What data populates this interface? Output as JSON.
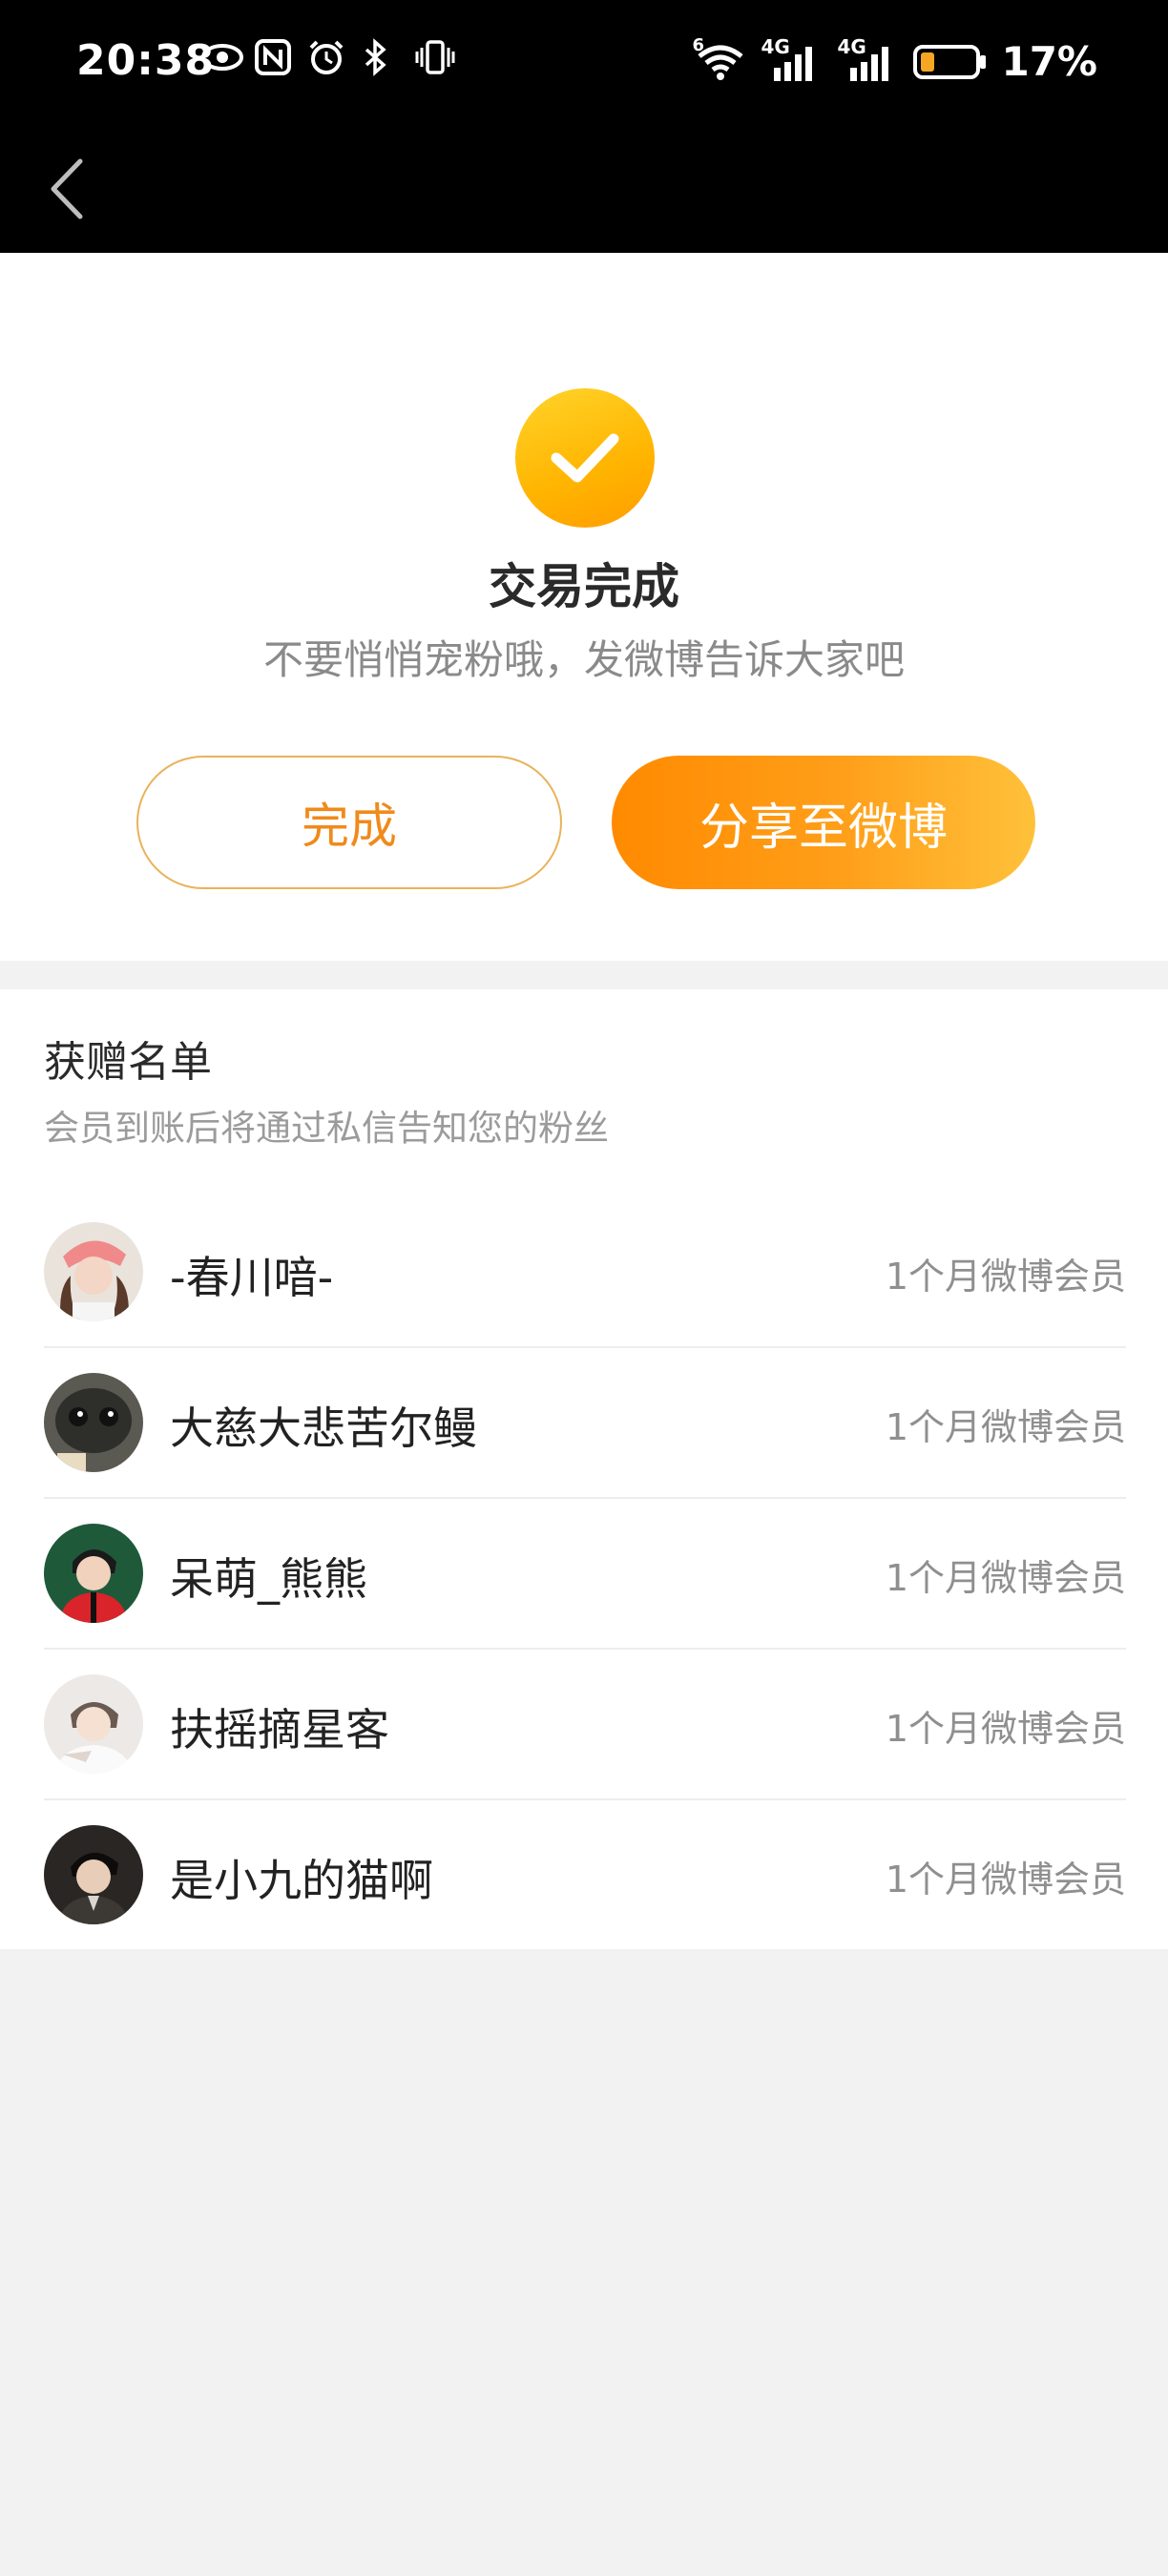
{
  "status_bar": {
    "time": "20:38",
    "battery_percent": "17%",
    "left_icons": [
      "eye-icon",
      "nfc-icon",
      "alarm-icon",
      "bluetooth-icon",
      "vibrate-icon"
    ],
    "right_icons": [
      "wifi-icon",
      "signal-4g-icon",
      "signal-4g-icon",
      "battery-icon"
    ],
    "signal_label_1": "4G",
    "signal_label_2": "4G",
    "wifi_label": "6"
  },
  "nav": {
    "back_icon": "chevron-left-icon"
  },
  "result": {
    "title": "交易完成",
    "subtitle": "不要悄悄宠粉哦，发微博告诉大家吧",
    "done_label": "完成",
    "share_label": "分享至微博",
    "accent_color": "#ffb400"
  },
  "recipients": {
    "title": "获赠名单",
    "subtitle": "会员到账后将通过私信告知您的粉丝",
    "items": [
      {
        "name": "-春川喑-",
        "gift": "1个月微博会员"
      },
      {
        "name": "大慈大悲苦尔鳗",
        "gift": "1个月微博会员"
      },
      {
        "name": "呆萌_熊熊",
        "gift": "1个月微博会员"
      },
      {
        "name": "扶摇摘星客",
        "gift": "1个月微博会员"
      },
      {
        "name": "是小九的猫啊",
        "gift": "1个月微博会员"
      }
    ]
  }
}
